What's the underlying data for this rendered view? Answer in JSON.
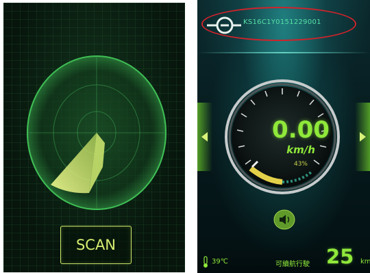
{
  "radar_screen": {
    "scan_button_label": "SCAN",
    "accent_color": "#d7ee71",
    "radar_color": "#3fbf55"
  },
  "dashboard_screen": {
    "device_id": "KS16C1Y0151229001",
    "speed": "0.00",
    "speed_unit": "km/h",
    "battery_percent": "43%",
    "temperature": "39℃",
    "range_label": "可續航行駛",
    "range_value": "25",
    "range_unit": "km",
    "accent_color": "#8fe83a",
    "highlight_color": "#d0232b",
    "icons": [
      "bluetooth-icon",
      "left-arrow-icon",
      "right-arrow-icon",
      "horn-icon",
      "thermometer-icon"
    ]
  }
}
